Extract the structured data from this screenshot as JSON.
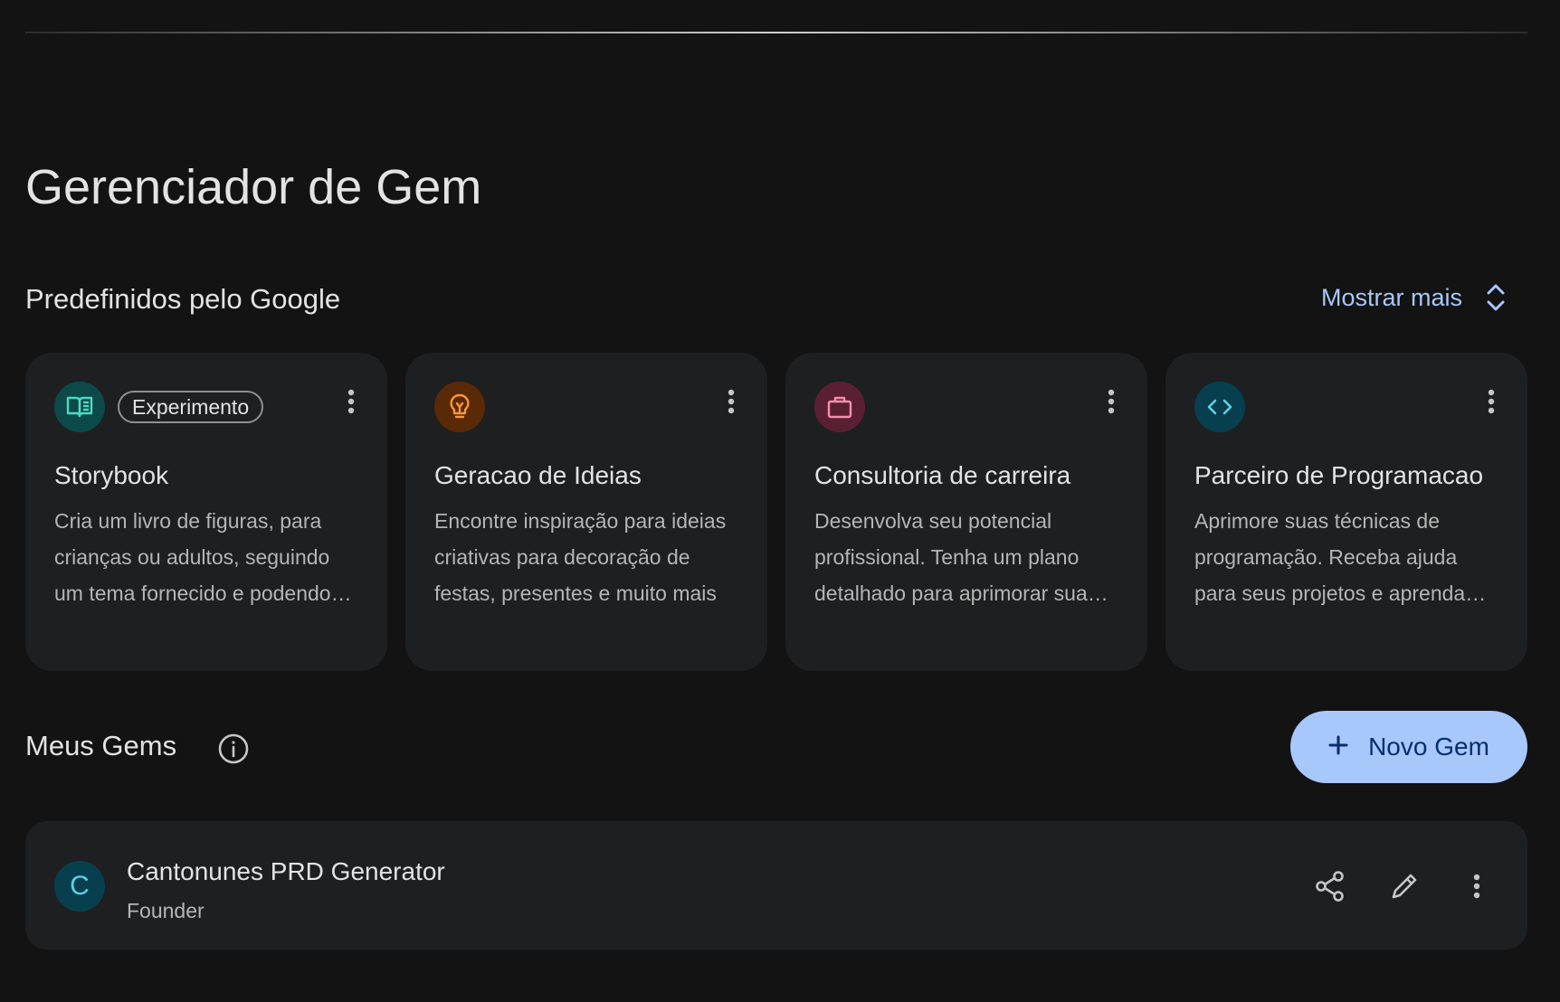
{
  "page": {
    "title": "Gerenciador de Gem"
  },
  "predefined": {
    "title": "Predefinidos pelo Google",
    "show_more_label": "Mostrar mais",
    "cards": [
      {
        "icon": "book-icon",
        "icon_bg": "#0b4a48",
        "icon_color": "#4fd8c6",
        "badge": "Experimento",
        "title": "Storybook",
        "description": "Cria um livro de figuras, para crianças ou adultos, seguindo um tema fornecido e podendo incluir imagens"
      },
      {
        "icon": "lightbulb-icon",
        "icon_bg": "#5a2a06",
        "icon_color": "#f7953b",
        "badge": "",
        "title": "Geracao de Ideias",
        "description": "Encontre inspiração para ideias criativas para decoração de festas, presentes e muito mais"
      },
      {
        "icon": "briefcase-icon",
        "icon_bg": "#5a1f33",
        "icon_color": "#f58fac",
        "badge": "",
        "title": "Consultoria de carreira",
        "description": "Desenvolva seu potencial profissional. Tenha um plano detalhado para aprimorar suas habilidades"
      },
      {
        "icon": "code-icon",
        "icon_bg": "#073f4f",
        "icon_color": "#5dd1ea",
        "badge": "",
        "title": "Parceiro de Programacao",
        "description": "Aprimore suas técnicas de programação. Receba ajuda para seus projetos e aprenda novas linguagens"
      }
    ]
  },
  "my_gems": {
    "title": "Meus Gems",
    "new_gem_label": "Novo Gem",
    "items": [
      {
        "initial": "C",
        "name": "Cantonunes PRD Generator",
        "subtitle": "Founder"
      }
    ]
  },
  "colors": {
    "background": "#131314",
    "surface": "#1e1f20",
    "accent": "#a8c7fa",
    "accent_text": "#062e6f"
  }
}
